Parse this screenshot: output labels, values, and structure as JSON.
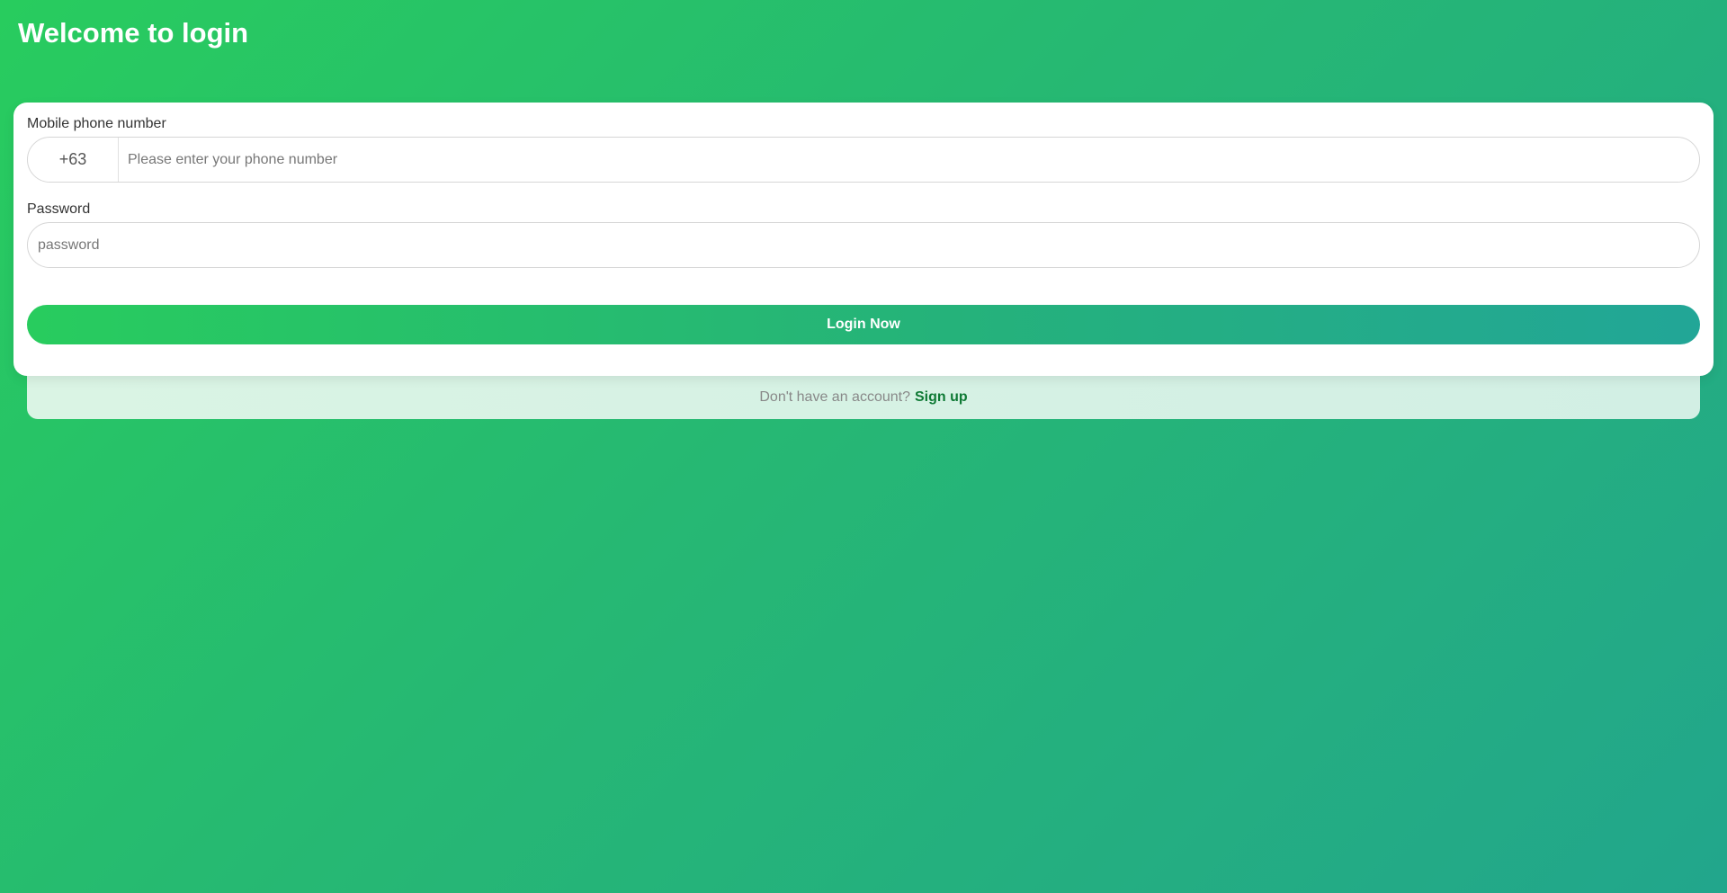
{
  "header": {
    "title": "Welcome to login"
  },
  "form": {
    "phone": {
      "label": "Mobile phone number",
      "country_code": "+63",
      "value": "",
      "placeholder": "Please enter your phone number"
    },
    "password": {
      "label": "Password",
      "value": "",
      "placeholder": "password"
    },
    "submit_label": "Login Now"
  },
  "footer": {
    "prompt": "Don't have an account?",
    "signup_label": "Sign up"
  },
  "colors": {
    "gradient_start": "#28cc5e",
    "gradient_end": "#22a68c",
    "link": "#0f7a35",
    "card": "#ffffff"
  }
}
